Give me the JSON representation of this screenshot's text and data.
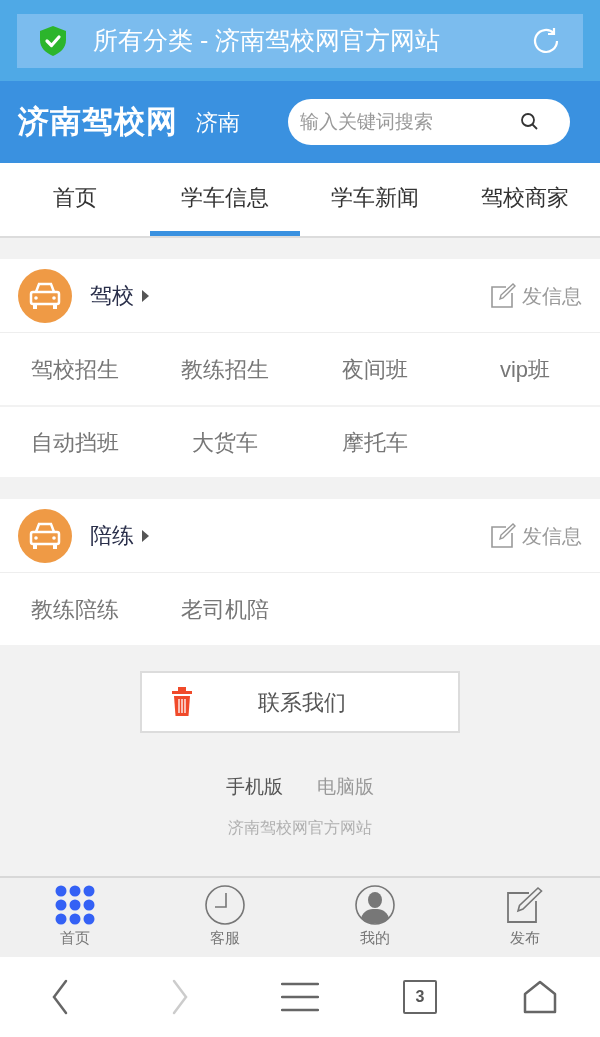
{
  "browser": {
    "title": "所有分类 - 济南驾校网官方网站"
  },
  "header": {
    "logo": "济南驾校网",
    "city": "济南",
    "search": {
      "placeholder": "输入关键词搜索"
    }
  },
  "tabs": [
    {
      "label": "首页",
      "selected": false
    },
    {
      "label": "学车信息",
      "selected": true
    },
    {
      "label": "学车新闻",
      "selected": false
    },
    {
      "label": "驾校商家",
      "selected": false
    }
  ],
  "sections": [
    {
      "title": "驾校",
      "post_label": "发信息",
      "links": [
        "驾校招生",
        "教练招生",
        "夜间班",
        "vip班",
        "自动挡班",
        "大货车",
        "摩托车"
      ]
    },
    {
      "title": "陪练",
      "post_label": "发信息",
      "links": [
        "教练陪练",
        "老司机陪"
      ]
    }
  ],
  "contact_button": "联系我们",
  "versions": [
    {
      "label": "手机版",
      "selected": true
    },
    {
      "label": "电脑版",
      "selected": false
    }
  ],
  "footer_text": "济南驾校网官方网站",
  "bottom_nav": [
    {
      "label": "首页",
      "kind": "grid",
      "selected": true
    },
    {
      "label": "客服",
      "kind": "clock",
      "selected": false
    },
    {
      "label": "我的",
      "kind": "user",
      "selected": false
    },
    {
      "label": "发布",
      "kind": "edit",
      "selected": false
    }
  ],
  "browser_toolbar": {
    "back_disabled": false,
    "forward_disabled": true,
    "tab_count": "3"
  }
}
